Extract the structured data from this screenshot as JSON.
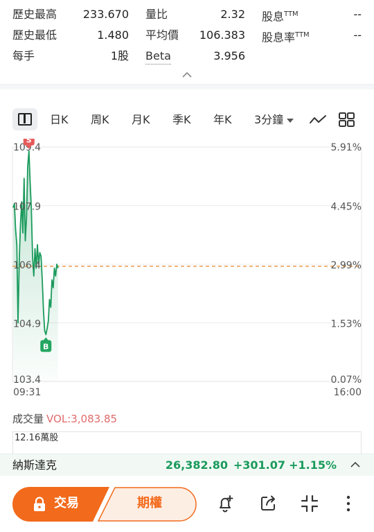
{
  "stats": {
    "hist_high_label": "歷史最高",
    "hist_high_value": "233.670",
    "hist_low_label": "歷史最低",
    "hist_low_value": "1.480",
    "lot_label": "每手",
    "lot_value": "1股",
    "vol_ratio_label": "量比",
    "vol_ratio_value": "2.32",
    "avg_price_label": "平均價",
    "avg_price_value": "106.383",
    "beta_label": "Beta",
    "beta_value": "3.956",
    "dividend_label": "股息",
    "dividend_sup": "TTM",
    "dividend_value": "--",
    "dividend_yield_label": "股息率",
    "dividend_yield_sup": "TTM",
    "dividend_yield_value": "--",
    "collapse_icon": "chevron-up-icon"
  },
  "tabs": {
    "layout_icon": "chart-layout-icon",
    "day": "日K",
    "week": "周K",
    "month": "月K",
    "quarter": "季K",
    "year": "年K",
    "interval": "3分鐘",
    "indicator_icon": "line-indicator-icon",
    "grid_icon": "grid-icon"
  },
  "chart_data": {
    "type": "line",
    "y_labels": [
      "109.4",
      "107.9",
      "106.4",
      "104.9",
      "103.4"
    ],
    "pct_labels": [
      "5.91%",
      "4.45%",
      "2.99%",
      "1.53%",
      "0.07%"
    ],
    "x_labels": [
      "09:31",
      "16:00"
    ],
    "ylim": [
      103.4,
      109.4
    ],
    "ref_price": 106.35,
    "ref_color": "#e8913a",
    "line_color": "#1a9a5c",
    "sell_marker": "S",
    "buy_marker": "B",
    "sell_color": "#e65a5a",
    "buy_color": "#23a660",
    "series": [
      {
        "values": [
          107.85,
          107.95,
          107.3,
          106.9,
          104.9,
          106.5,
          107.4,
          108.0,
          107.2,
          108.6,
          107.0,
          107.6,
          108.9,
          109.3,
          108.5,
          107.8,
          106.6,
          106.1,
          106.8,
          106.3,
          106.9,
          106.4,
          106.7,
          106.6,
          106.0,
          105.2,
          104.7,
          104.6,
          104.75,
          104.95,
          105.5,
          105.3,
          106.0,
          105.8,
          106.3,
          106.1,
          106.4,
          106.3
        ]
      }
    ]
  },
  "volume": {
    "title": "成交量",
    "value": "VOL:3,083.85",
    "max_label": "12.16萬股"
  },
  "index": {
    "name": "納斯達克",
    "price": "26,382.80",
    "change": "+301.07",
    "change_pct": "+1.15%",
    "expand_icon": "chevron-up-icon"
  },
  "bottom": {
    "lock_icon": "lock-icon",
    "trade_label": "交易",
    "options_label": "期權",
    "alert_icon": "bell-plus-icon",
    "share_icon": "share-icon",
    "fullscreen_icon": "collapse-arrows-icon",
    "more_icon": "more-vertical-icon",
    "accent": "#f26a1b"
  }
}
